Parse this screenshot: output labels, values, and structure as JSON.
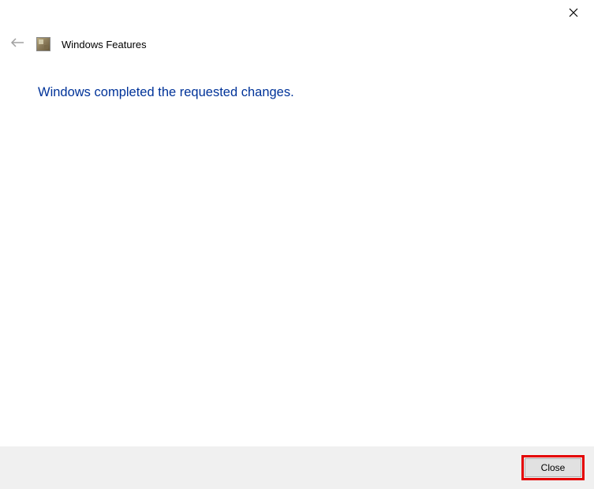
{
  "window": {
    "title": "Windows Features"
  },
  "main": {
    "message": "Windows completed the requested changes."
  },
  "footer": {
    "close_label": "Close"
  }
}
